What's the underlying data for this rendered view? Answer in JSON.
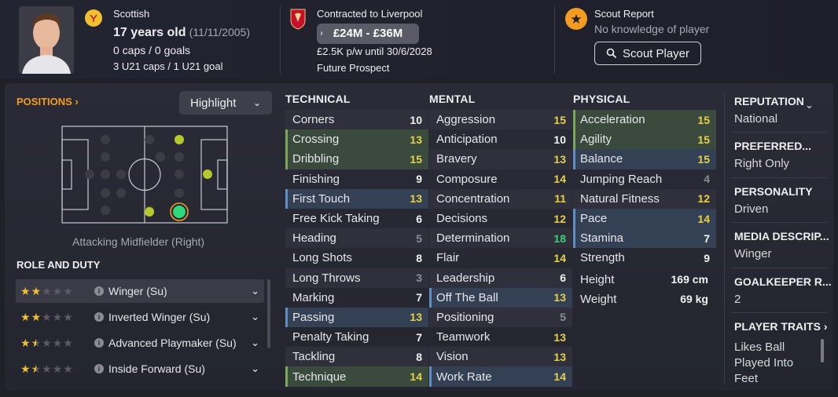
{
  "header": {
    "nationality": "Scottish",
    "age_text": "17 years old",
    "dob": "(11/11/2005)",
    "caps_goals": "0 caps / 0 goals",
    "u21": "3 U21 caps / 1 U21 goal",
    "contract_title": "Contracted to Liverpool",
    "value_range": "£24M - £36M",
    "wage": "£2.5K p/w until 30/6/2028",
    "status": "Future Prospect",
    "scout_title": "Scout Report",
    "scout_sub": "No knowledge of player",
    "scout_button": "Scout Player"
  },
  "positions": {
    "label": "POSITIONS",
    "highlight_select": "Highlight",
    "position_name": "Attacking Midfielder (Right)"
  },
  "roles": {
    "heading": "ROLE AND DUTY",
    "items": [
      {
        "label": "Winger (Su)",
        "stars": 2
      },
      {
        "label": "Inverted Winger (Su)",
        "stars": 2
      },
      {
        "label": "Advanced Playmaker (Su)",
        "stars": 1.5
      },
      {
        "label": "Inside Forward (Su)",
        "stars": 1.5
      }
    ]
  },
  "technical": {
    "heading": "TECHNICAL",
    "rows": [
      {
        "label": "Corners",
        "value": "10"
      },
      {
        "label": "Crossing",
        "value": "13"
      },
      {
        "label": "Dribbling",
        "value": "15"
      },
      {
        "label": "Finishing",
        "value": "9"
      },
      {
        "label": "First Touch",
        "value": "13"
      },
      {
        "label": "Free Kick Taking",
        "value": "6"
      },
      {
        "label": "Heading",
        "value": "5"
      },
      {
        "label": "Long Shots",
        "value": "8"
      },
      {
        "label": "Long Throws",
        "value": "3"
      },
      {
        "label": "Marking",
        "value": "7"
      },
      {
        "label": "Passing",
        "value": "13"
      },
      {
        "label": "Penalty Taking",
        "value": "7"
      },
      {
        "label": "Tackling",
        "value": "8"
      },
      {
        "label": "Technique",
        "value": "14"
      }
    ]
  },
  "mental": {
    "heading": "MENTAL",
    "rows": [
      {
        "label": "Aggression",
        "value": "15"
      },
      {
        "label": "Anticipation",
        "value": "10"
      },
      {
        "label": "Bravery",
        "value": "13"
      },
      {
        "label": "Composure",
        "value": "14"
      },
      {
        "label": "Concentration",
        "value": "11"
      },
      {
        "label": "Decisions",
        "value": "12"
      },
      {
        "label": "Determination",
        "value": "18"
      },
      {
        "label": "Flair",
        "value": "14"
      },
      {
        "label": "Leadership",
        "value": "6"
      },
      {
        "label": "Off The Ball",
        "value": "13"
      },
      {
        "label": "Positioning",
        "value": "5"
      },
      {
        "label": "Teamwork",
        "value": "13"
      },
      {
        "label": "Vision",
        "value": "13"
      },
      {
        "label": "Work Rate",
        "value": "14"
      }
    ]
  },
  "physical": {
    "heading": "PHYSICAL",
    "rows": [
      {
        "label": "Acceleration",
        "value": "15"
      },
      {
        "label": "Agility",
        "value": "15"
      },
      {
        "label": "Balance",
        "value": "15"
      },
      {
        "label": "Jumping Reach",
        "value": "4"
      },
      {
        "label": "Natural Fitness",
        "value": "12"
      },
      {
        "label": "Pace",
        "value": "14"
      },
      {
        "label": "Stamina",
        "value": "7"
      },
      {
        "label": "Strength",
        "value": "9"
      }
    ],
    "height_label": "Height",
    "height_value": "169 cm",
    "weight_label": "Weight",
    "weight_value": "69 kg"
  },
  "info": {
    "reputation_h": "REPUTATION",
    "reputation_v": "National",
    "preferred_h": "PREFERRED...",
    "preferred_v": "Right Only",
    "personality_h": "PERSONALITY",
    "personality_v": "Driven",
    "media_h": "MEDIA DESCRIP...",
    "media_v": "Winger",
    "gk_h": "GOALKEEPER R...",
    "gk_v": "2",
    "traits_h": "PLAYER TRAITS",
    "traits_v1": "Likes Ball",
    "traits_v2": "Played Into",
    "traits_v3": "Feet"
  },
  "colors": {
    "accent_orange": "#f39c22",
    "value_yellow": "#e6d24a",
    "value_green": "#39d07a",
    "highlight_green": "#7ca85a",
    "highlight_blue": "#5f8fc4"
  }
}
